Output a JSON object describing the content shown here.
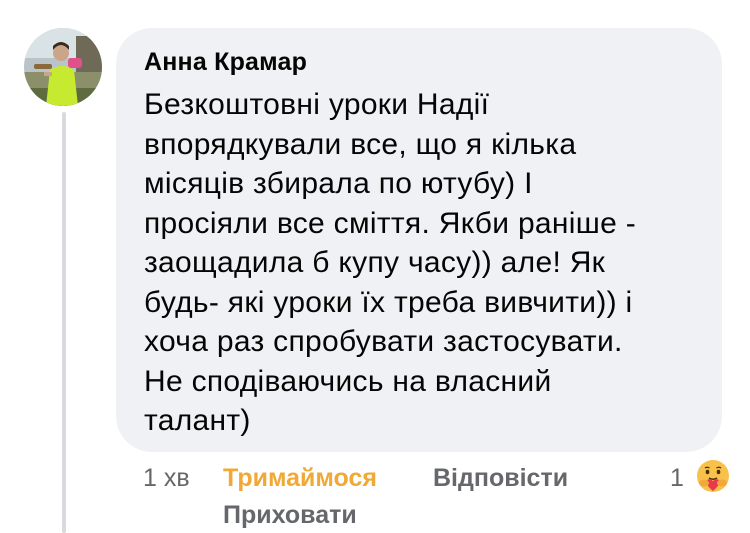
{
  "comment": {
    "author": "Анна Крамар",
    "lines": [
      "Безкоштовні уроки Надії",
      "впорядкували все, що я кілька",
      "місяців збирала по ютубу) І",
      "просіяли все сміття. Якби раніше -",
      "заощадила б купу часу)) але! Як",
      "будь- які уроки їх треба вивчити)) і",
      "хоча раз спробувати застосувати.",
      "Не сподіваючись на власний",
      "талант)"
    ]
  },
  "actions": {
    "time": "1 хв",
    "react_label": "Тримаймося",
    "reply_label": "Відповісти",
    "hide_label": "Приховати",
    "reaction_count": "1"
  },
  "icons": {
    "avatar": "user-photo",
    "reaction": "care-reaction-icon"
  },
  "colors": {
    "bubble": "#f0f1f4",
    "react_accent": "#f0a936",
    "secondary_text": "#65676b",
    "primary_text": "#050505"
  }
}
